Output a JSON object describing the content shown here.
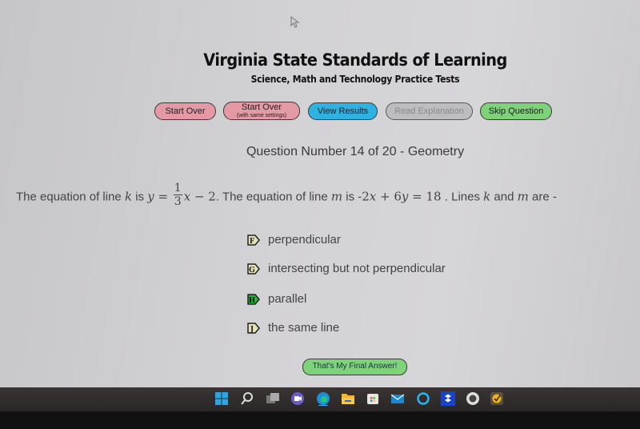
{
  "header": {
    "title": "Virginia State Standards of Learning",
    "subtitle": "Science, Math and Technology Practice Tests"
  },
  "toolbar": {
    "start_over": "Start Over",
    "start_over_same": "Start Over",
    "start_over_same_note": "(with same settings)",
    "view_results": "View Results",
    "read_explanation": "Read Explanation",
    "skip_question": "Skip Question"
  },
  "question": {
    "number_label": "Question Number 14 of 20 - Geometry",
    "t1": "The equation of line ",
    "var_k": "k",
    "t2": " is ",
    "var_y": "y",
    "eq": " = ",
    "frac_num": "1",
    "frac_den": "3",
    "var_x": "x",
    "t3": " − 2",
    "t4": ". The equation of line ",
    "var_m": "m",
    "t5": " is -",
    "eq2a": "2",
    "var_x2": "x",
    "eq2b": " + 6",
    "var_y2": "y",
    "eq2c": " = 18",
    "t6": " . Lines ",
    "var_k2": "k",
    "t7": " and ",
    "var_m2": "m",
    "t8": " are -"
  },
  "choices": [
    {
      "letter": "F",
      "text": "perpendicular",
      "selected": false
    },
    {
      "letter": "G",
      "text": "intersecting but not perpendicular",
      "selected": false
    },
    {
      "letter": "H",
      "text": "parallel",
      "selected": true
    },
    {
      "letter": "J",
      "text": "the same line",
      "selected": false
    }
  ],
  "submit": {
    "label": "That's My Final Answer!"
  },
  "colors": {
    "start_over": "#e39aa4",
    "view_results": "#2fb1e2",
    "read_explanation": "#bdbdc0",
    "skip_question": "#7dd27a",
    "selected_tag": "#27b33a",
    "unselected_tag": "#e6e2b8"
  },
  "taskbar": {
    "icons": [
      "windows-start-icon",
      "search-icon",
      "task-view-icon",
      "teams-chat-icon",
      "edge-icon",
      "file-explorer-icon",
      "store-icon",
      "mail-icon",
      "cortana-icon",
      "dropbox-icon",
      "app-icon",
      "norton-icon"
    ]
  }
}
